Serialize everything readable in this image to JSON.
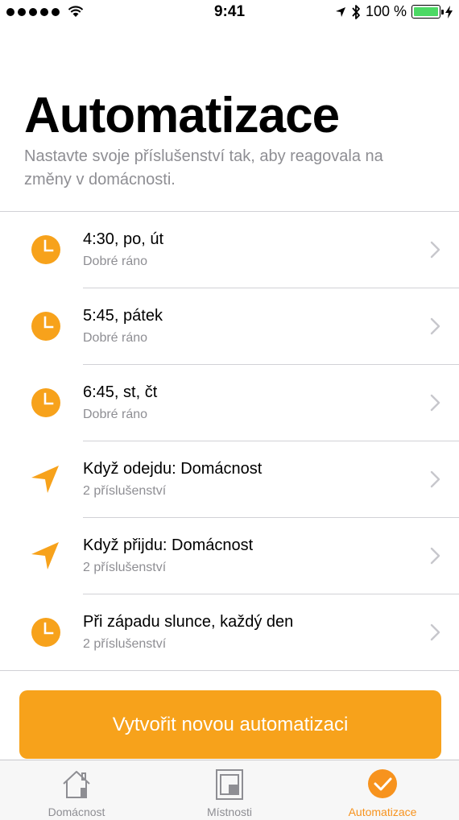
{
  "status_bar": {
    "time": "9:41",
    "battery": "100 %",
    "battery_level": 1.0,
    "signal_dots": 5,
    "icons": [
      "wifi-icon",
      "location-arrow-icon",
      "bluetooth-icon",
      "battery-icon",
      "charging-icon"
    ]
  },
  "header": {
    "title": "Automatizace",
    "subtitle": "Nastavte svoje příslušenství tak, aby reagovala na změny v domácnosti."
  },
  "automations": [
    {
      "icon": "clock-icon",
      "title": "4:30, po, út",
      "subtitle": "Dobré ráno"
    },
    {
      "icon": "clock-icon",
      "title": "5:45, pátek",
      "subtitle": "Dobré ráno"
    },
    {
      "icon": "clock-icon",
      "title": "6:45, st, čt",
      "subtitle": "Dobré ráno"
    },
    {
      "icon": "location-icon",
      "title": "Když odejdu: Domácnost",
      "subtitle": "2 příslušenství"
    },
    {
      "icon": "location-icon",
      "title": "Když přijdu: Domácnost",
      "subtitle": "2 příslušenství"
    },
    {
      "icon": "clock-icon",
      "title": "Při západu slunce, každý den",
      "subtitle": "2 příslušenství"
    }
  ],
  "cta": {
    "label": "Vytvořit novou automatizaci"
  },
  "tabs": [
    {
      "label": "Domácnost",
      "icon": "home-icon",
      "active": false
    },
    {
      "label": "Místnosti",
      "icon": "rooms-icon",
      "active": false
    },
    {
      "label": "Automatizace",
      "icon": "automation-icon",
      "active": true
    }
  ],
  "colors": {
    "accent": "#f7a21b",
    "secondary_text": "#8e8e93",
    "separator": "#d1d1d6",
    "battery": "#4cd964"
  }
}
